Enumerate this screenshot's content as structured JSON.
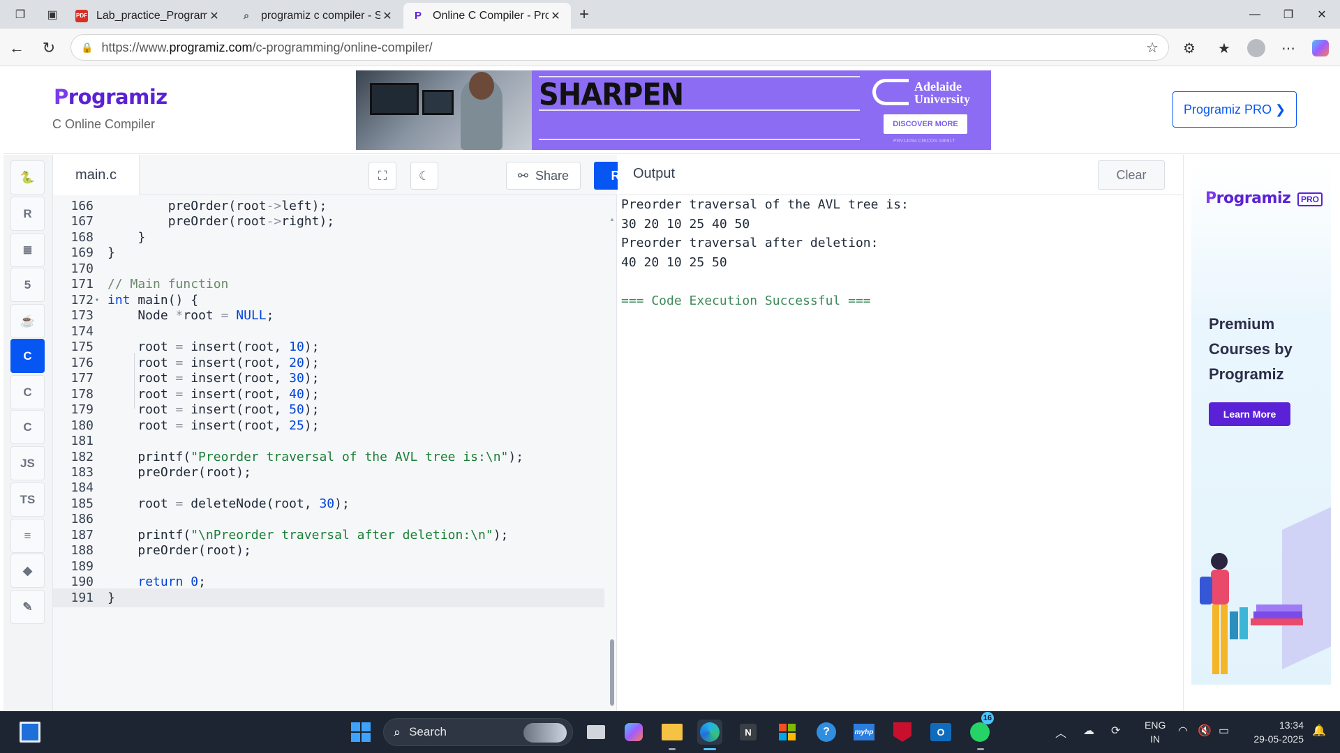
{
  "browser": {
    "tabs": [
      {
        "label": "Lab_practice_Programs[1].pdf",
        "favicon": "PDF"
      },
      {
        "label": "programiz c compiler - Search",
        "favicon": "search"
      },
      {
        "label": "Online C Compiler - Programiz",
        "favicon": "P"
      }
    ],
    "url_prefix": "https://www.",
    "url_host": "programiz.com",
    "url_path": "/c-programming/online-compiler/"
  },
  "header": {
    "logo": "rogramiz",
    "logo_p": "P",
    "subtitle": "C Online Compiler",
    "pro_button": "Programiz PRO ❯"
  },
  "banner_ad": {
    "headline": "SHARPEN",
    "brand_line1": "Adelaide",
    "brand_line2": "University",
    "cta": "DISCOVER MORE",
    "fine_print": "PRV14094 CRICOS 04691T"
  },
  "sidebar": {
    "languages": [
      {
        "name": "python",
        "label": "🐍"
      },
      {
        "name": "r",
        "label": "R"
      },
      {
        "name": "sql",
        "label": "≣"
      },
      {
        "name": "html",
        "label": "5"
      },
      {
        "name": "java",
        "label": "☕"
      },
      {
        "name": "c",
        "label": "C"
      },
      {
        "name": "cpp",
        "label": "C"
      },
      {
        "name": "csharp",
        "label": "C"
      },
      {
        "name": "javascript",
        "label": "JS"
      },
      {
        "name": "typescript",
        "label": "TS"
      },
      {
        "name": "go",
        "label": "≡"
      },
      {
        "name": "swift",
        "label": "◆"
      },
      {
        "name": "rust",
        "label": "✎"
      }
    ]
  },
  "editor": {
    "filename": "main.c",
    "share_label": "Share",
    "run_label": "Run",
    "lines": [
      {
        "n": "166",
        "html": "        <span>preOrder(root</span><span class='op'>-&gt;</span><span>left);</span>"
      },
      {
        "n": "167",
        "html": "        <span>preOrder(root</span><span class='op'>-&gt;</span><span>right);</span>"
      },
      {
        "n": "168",
        "html": "    }"
      },
      {
        "n": "169",
        "html": "}"
      },
      {
        "n": "170",
        "html": ""
      },
      {
        "n": "171",
        "html": "<span class='cm'>// Main function</span>"
      },
      {
        "n": "172",
        "html": "<span class='kw'>int</span> main() {",
        "fold": true
      },
      {
        "n": "173",
        "html": "    Node <span class='op'>*</span>root <span class='op'>=</span> <span class='nul'>NULL</span>;"
      },
      {
        "n": "174",
        "html": ""
      },
      {
        "n": "175",
        "html": "    root <span class='op'>=</span> insert(root, <span class='num'>10</span>);"
      },
      {
        "n": "176",
        "html": "    root <span class='op'>=</span> insert(root, <span class='num'>20</span>);"
      },
      {
        "n": "177",
        "html": "    root <span class='op'>=</span> insert(root, <span class='num'>30</span>);"
      },
      {
        "n": "178",
        "html": "    root <span class='op'>=</span> insert(root, <span class='num'>40</span>);"
      },
      {
        "n": "179",
        "html": "    root <span class='op'>=</span> insert(root, <span class='num'>50</span>);"
      },
      {
        "n": "180",
        "html": "    root <span class='op'>=</span> insert(root, <span class='num'>25</span>);"
      },
      {
        "n": "181",
        "html": ""
      },
      {
        "n": "182",
        "html": "    printf(<span class='str'>\"Preorder traversal of the AVL tree is:\\n\"</span>);"
      },
      {
        "n": "183",
        "html": "    preOrder(root);"
      },
      {
        "n": "184",
        "html": ""
      },
      {
        "n": "185",
        "html": "    root <span class='op'>=</span> deleteNode(root, <span class='num'>30</span>);"
      },
      {
        "n": "186",
        "html": ""
      },
      {
        "n": "187",
        "html": "    printf(<span class='str'>\"\\nPreorder traversal after deletion:\\n\"</span>);"
      },
      {
        "n": "188",
        "html": "    preOrder(root);"
      },
      {
        "n": "189",
        "html": ""
      },
      {
        "n": "190",
        "html": "    <span class='kw'>return</span> <span class='num'>0</span>;"
      },
      {
        "n": "191",
        "html": "}",
        "highlight": true
      }
    ]
  },
  "output": {
    "title": "Output",
    "clear_label": "Clear",
    "lines": [
      "Preorder traversal of the AVL tree is:",
      "30 20 10 25 40 50",
      "Preorder traversal after deletion:",
      "40 20 10 25 50",
      "",
      "=== Code Execution Successful ==="
    ]
  },
  "right_ad": {
    "logo": "rogramiz",
    "logo_p": "P",
    "pro_tag": "PRO",
    "text_line1": "Premium",
    "text_line2": "Courses by",
    "text_line3": "Programiz",
    "button": "Learn More"
  },
  "taskbar": {
    "search_placeholder": "Search",
    "whatsapp_badge": "16",
    "lang_line1": "ENG",
    "lang_line2": "IN",
    "time": "13:34",
    "date": "29-05-2025"
  }
}
